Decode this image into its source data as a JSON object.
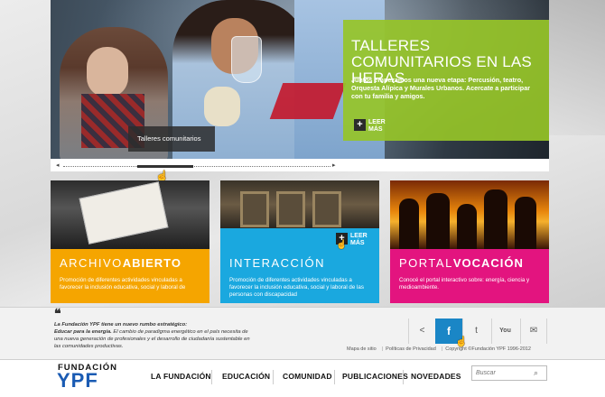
{
  "hero": {
    "title": "TALLERES COMUNITARIOS EN LAS HERAS",
    "text": "Juntos empezamos una nueva etapa: Percusión, teatro, Orquesta Alípica y Murales Urbanos. Acercate a participar con tu familia y amigos.",
    "leer_mas": "LEER MÁS",
    "caption": "Talleres comunitarios"
  },
  "cards": [
    {
      "title_light": "ARCHIVO",
      "title_bold": "ABIERTO",
      "text": "Promoción de diferentes actividades vinculadas a favorecer la inclusión educativa, social y laboral de",
      "color": "#f5a500"
    },
    {
      "title_light": "INTERACCIÓN",
      "title_bold": "",
      "text": "Promoción de diferentes actividades vinculadas a favorecer la inclusión educativa, social y laboral de las personas con discapacidad",
      "color": "#1aa8df",
      "leer_mas": "LEER MÁS"
    },
    {
      "title_light": "PORTAL",
      "title_bold": "VOCACIÓN",
      "text": "Conocé el portal interactivo sobre: energía, ciencia y medioambiente.",
      "color": "#e3147f"
    }
  ],
  "quote": {
    "line1": "La Fundación YPF tiene un nuevo rumbo estratégico:",
    "line2_bold": "Educar para la energía.",
    "line2_rest": " El cambio de paradigma energético en el país necesita de una nueva generación de profesionales y el desarrollo de ciudadanía sustentable en las comunidades productivas."
  },
  "social": {
    "share_icon": "share-icon",
    "facebook": "f",
    "twitter": "twitter-icon",
    "youtube": "You",
    "email": "mail-icon"
  },
  "footer_links": {
    "map": "Mapa de sitio",
    "privacy": "Políticas de Privacidad",
    "copyright": "Copyright ©Fundación YPF 1996-2012"
  },
  "logo": {
    "top": "FUNDACIÓN",
    "bottom": "YPF"
  },
  "nav": [
    "LA FUNDACIÓN",
    "EDUCACIÓN",
    "COMUNIDAD",
    "PUBLICACIONES",
    "NOVEDADES"
  ],
  "search": {
    "placeholder": "Buscar"
  }
}
